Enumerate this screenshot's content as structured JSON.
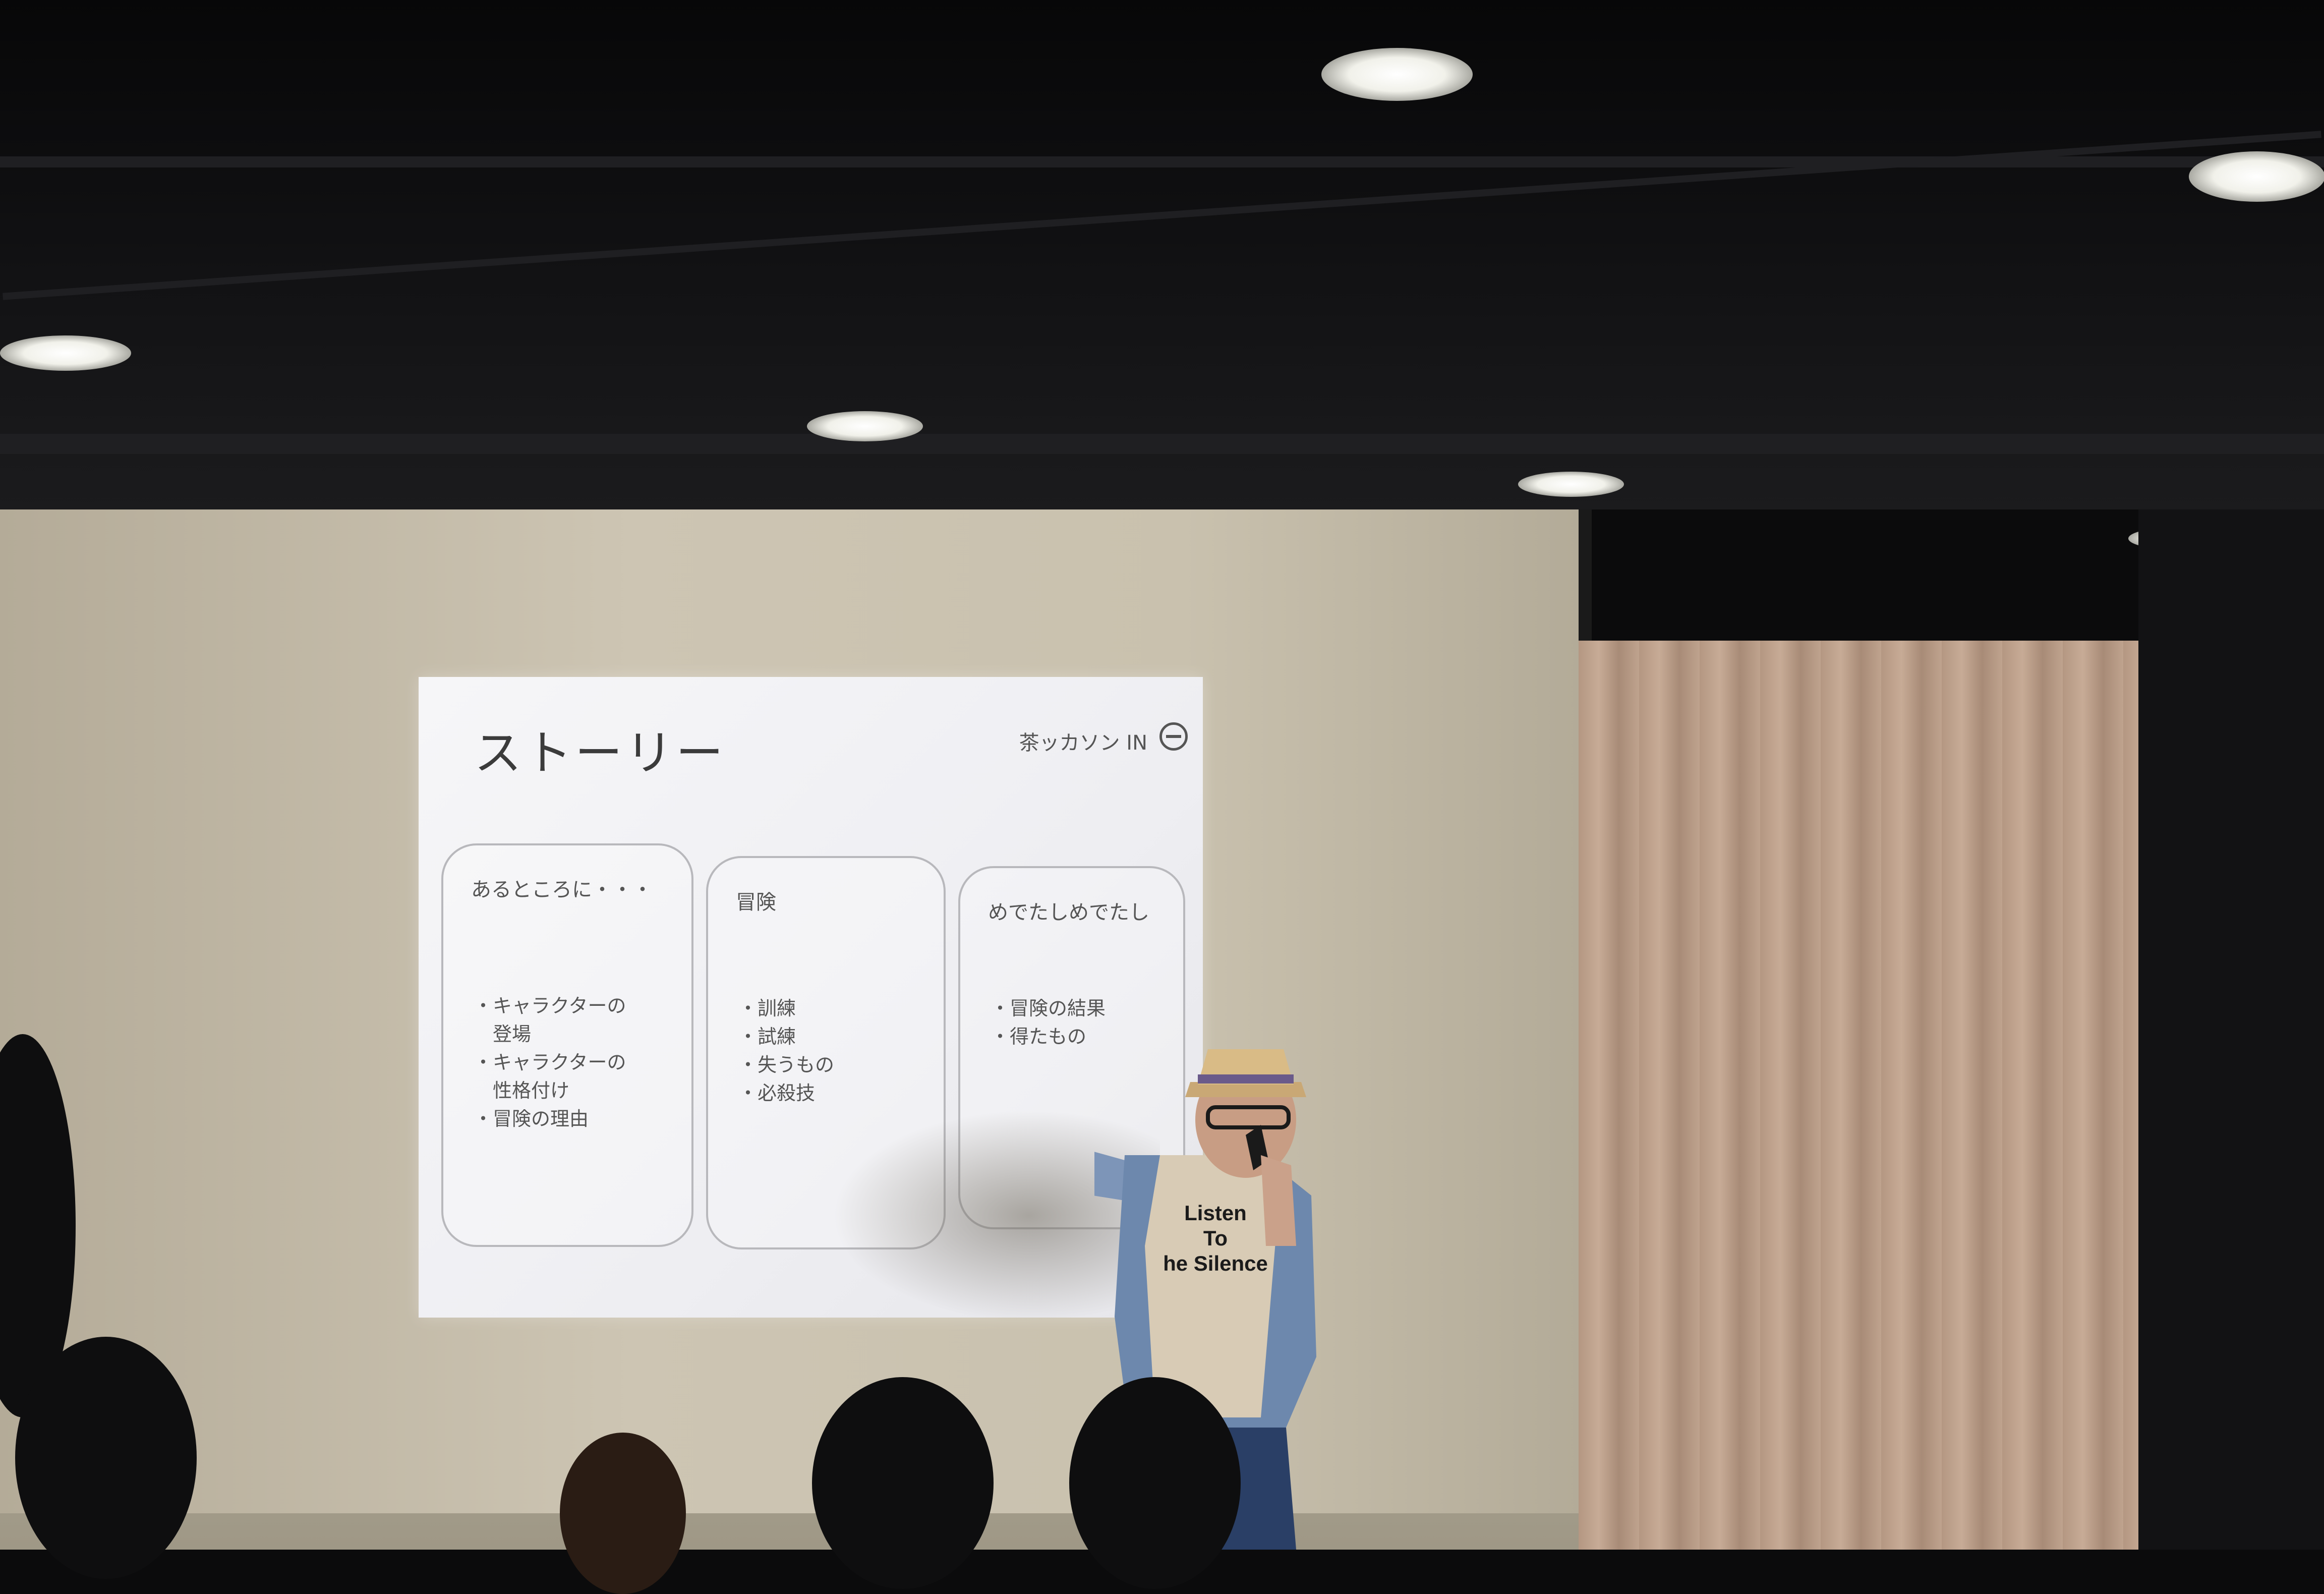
{
  "slide": {
    "title": "ストーリー",
    "brand": "茶ッカソン IN",
    "columns": [
      {
        "heading": "あるところに・・・",
        "items": [
          "・キャラクターの",
          "登場",
          "・キャラクターの",
          "性格付け",
          "・冒険の理由"
        ]
      },
      {
        "heading": "冒険",
        "items": [
          "・訓練",
          "・試練",
          "・失うもの",
          "・必殺技"
        ]
      },
      {
        "heading": "めでたしめでたし",
        "items": [
          "・冒険の結果",
          "・得たもの"
        ]
      }
    ]
  },
  "tshirt": {
    "line1": "Listen",
    "line2": "To",
    "line3": "he Silence"
  }
}
